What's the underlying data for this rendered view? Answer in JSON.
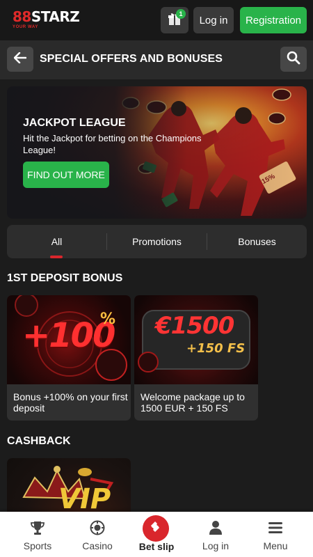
{
  "header": {
    "logo_main_a": "8",
    "logo_main_sep": "8",
    "logo_main_b": "STARZ",
    "logo_sub": "YOUR WAY",
    "gift_count": "1",
    "login_label": "Log in",
    "registration_label": "Registration"
  },
  "page": {
    "title": "SPECIAL OFFERS AND BONUSES"
  },
  "banner": {
    "title": "JACKPOT LEAGUE",
    "subtitle": "Hit the Jackpot for betting on the Champions League!",
    "button_label": "FIND OUT MORE",
    "ticket_label": "15%"
  },
  "tabs": [
    {
      "label": "All",
      "active": true
    },
    {
      "label": "Promotions",
      "active": false
    },
    {
      "label": "Bonuses",
      "active": false
    }
  ],
  "sections": [
    {
      "title": "1ST DEPOSIT BONUS",
      "cards": [
        {
          "title": "Bonus +100% on your first deposit",
          "art_text": "+100",
          "art_sup": "%"
        },
        {
          "title": "Welcome package up to 1500 EUR + 150 FS",
          "art_text": "€1500",
          "art_sub": "+150 FS"
        }
      ]
    },
    {
      "title": "CASHBACK",
      "cards": [
        {
          "art_text": "VIP"
        }
      ]
    }
  ],
  "bottom_nav": [
    {
      "label": "Sports",
      "icon": "trophy-icon"
    },
    {
      "label": "Casino",
      "icon": "casino-chip-icon"
    },
    {
      "label": "Bet slip",
      "icon": "ticket-icon"
    },
    {
      "label": "Log in",
      "icon": "user-icon"
    },
    {
      "label": "Menu",
      "icon": "menu-icon"
    }
  ],
  "colors": {
    "brand_red": "#e02a2a",
    "accent_green": "#29b34a",
    "background": "#1c1c1c"
  }
}
